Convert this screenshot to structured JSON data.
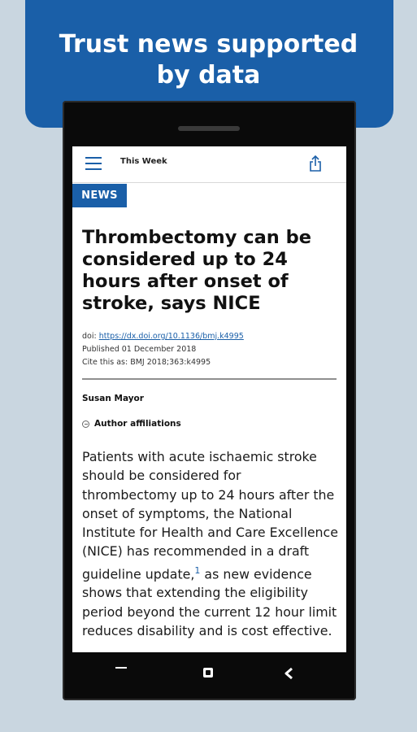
{
  "promo": {
    "title_line1": "Trust news supported",
    "title_line2": "by data",
    "banner_color": "#1a5fa8"
  },
  "app_bar": {
    "menu_icon": "hamburger-menu-icon",
    "title": "This Week",
    "share_icon": "share-icon"
  },
  "article": {
    "section_badge": "NEWS",
    "headline": "Thrombectomy can be considered up to 24 hours after onset of stroke, says NICE",
    "doi_label": "doi: ",
    "doi_link": "https://dx.doi.org/10.1136/bmj.k4995",
    "published": "Published 01 December 2018",
    "cite": "Cite this as: BMJ 2018;363:k4995",
    "author": "Susan Mayor",
    "affiliations_label": "Author affiliations",
    "body_part1": "Patients with acute ischaemic stroke should be considered for thrombectomy up to 24 hours after the onset of symptoms, the National Institute for Health and Care Excellence (NICE) has recommended in a draft guideline update,",
    "body_ref": "1",
    "body_part2": " as new evidence shows that extending the eligibility period beyond the current 12 hour limit reduces disability and is cost effective."
  },
  "nav": {
    "recent_icon": "recent-apps-icon",
    "home_icon": "home-icon",
    "back_icon": "back-icon"
  }
}
